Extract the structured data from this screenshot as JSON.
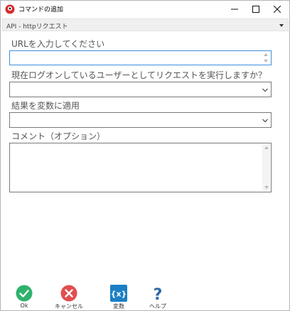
{
  "window": {
    "title": "コマンドの追加",
    "controls": {
      "minimize_icon": "minimize-icon",
      "maximize_icon": "maximize-icon",
      "close_icon": "close-icon"
    }
  },
  "command_select": {
    "value": "API - httpリクエスト"
  },
  "form": {
    "url": {
      "label": "URLを入力してください",
      "value": ""
    },
    "login_user": {
      "label": "現在ログオンしているユーザーとしてリクエストを実行しますか？",
      "value": ""
    },
    "result_var": {
      "label": "結果を変数に適用",
      "value": ""
    },
    "comment": {
      "label": "コメント（オプション）",
      "value": ""
    }
  },
  "toolbar": {
    "ok_label": "Ok",
    "cancel_label": "キャンセル",
    "variable_label": "変数",
    "variable_icon_text": "{x}",
    "help_label": "ヘルプ",
    "help_icon_text": "?"
  },
  "colors": {
    "ok": "#2fb26c",
    "cancel": "#e04f4f",
    "variable": "#1b7fc4",
    "help": "#2e6aa6",
    "focus_border": "#3c8edc"
  }
}
